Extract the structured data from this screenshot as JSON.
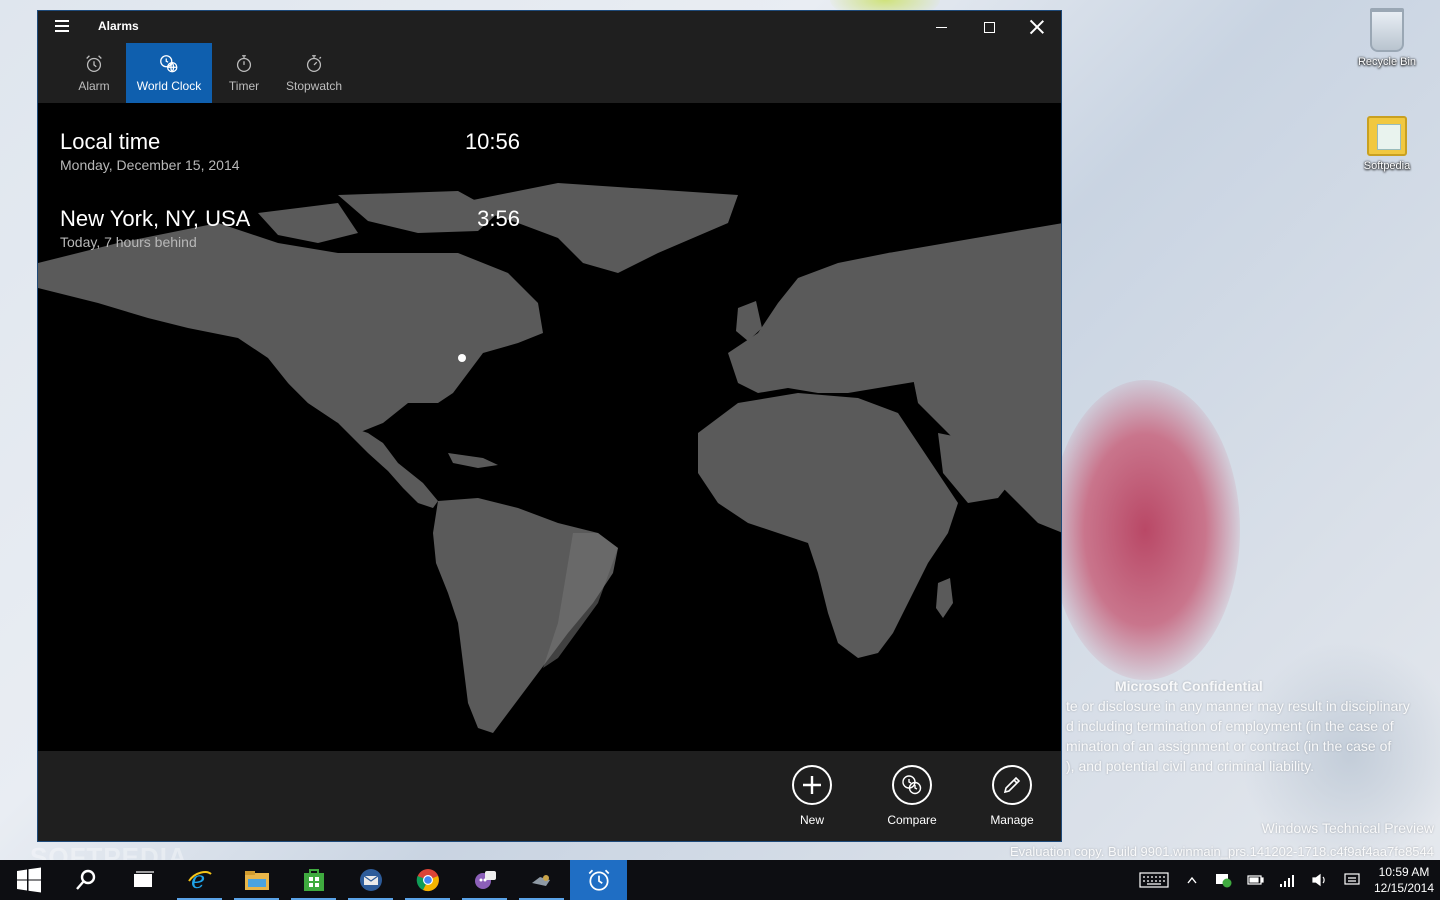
{
  "desktop": {
    "icons": [
      {
        "label": "Recycle Bin"
      },
      {
        "label": "Softpedia"
      }
    ],
    "watermark": {
      "confidential": "Microsoft Confidential",
      "paragraph": "te or disclosure in any manner may result in disciplinary\nd including termination of employment (in the case of\nmination of an assignment or contract (in the case of\n), and potential civil and criminal liability.",
      "edition": "Windows Technical Preview",
      "build": "Evaluation copy. Build 9901.winmain_prs.141202-1718.c4f9af4aa7fe8544"
    },
    "softpedia_mark": "SOFTPEDIA"
  },
  "window": {
    "title": "Alarms",
    "tabs": [
      {
        "label": "Alarm",
        "icon": "alarm-clock-icon"
      },
      {
        "label": "World Clock",
        "icon": "world-clock-icon"
      },
      {
        "label": "Timer",
        "icon": "timer-icon"
      },
      {
        "label": "Stopwatch",
        "icon": "stopwatch-icon"
      }
    ],
    "active_tab": "World Clock"
  },
  "clocks": [
    {
      "name": "Local time",
      "time": "10:56",
      "detail": "Monday, December 15, 2014"
    },
    {
      "name": "New York, NY, USA",
      "time": "3:56",
      "detail": "Today, 7 hours behind"
    }
  ],
  "commands": [
    {
      "label": "New",
      "icon": "plus-icon"
    },
    {
      "label": "Compare",
      "icon": "compare-clock-icon"
    },
    {
      "label": "Manage",
      "icon": "pencil-icon"
    }
  ],
  "taskbar": {
    "apps": [
      "start-icon",
      "search-icon",
      "task-view-icon",
      "internet-explorer-icon",
      "file-explorer-icon",
      "store-icon",
      "thunderbird-icon",
      "chrome-icon",
      "messenger-icon",
      "app-icon",
      "alarms-icon"
    ],
    "clock_time": "10:59 AM",
    "clock_date": "12/15/2014"
  },
  "colors": {
    "accent": "#0f5fae",
    "land": "#5a5a5a",
    "chrome": "#1f1f1f"
  }
}
